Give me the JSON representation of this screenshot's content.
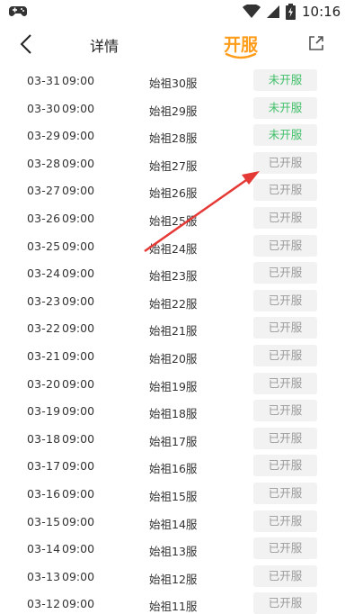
{
  "status_bar": {
    "time": "10:16",
    "icons": [
      "gamepad-icon",
      "wifi-icon",
      "signal-icon",
      "battery-icon"
    ]
  },
  "nav": {
    "title": "详情",
    "tab_label": "开服",
    "accent_color": "#ff9c1a"
  },
  "colors": {
    "upcoming_text": "#3fbf68",
    "opened_text": "#9a9a9a",
    "status_bg": "#f2f2f2",
    "annotation_arrow": "#e53935"
  },
  "servers": [
    {
      "date": "03-31",
      "time": "09:00",
      "name": "始祖30服",
      "status": "未开服",
      "state": "upcoming"
    },
    {
      "date": "03-30",
      "time": "09:00",
      "name": "始祖29服",
      "status": "未开服",
      "state": "upcoming"
    },
    {
      "date": "03-29",
      "time": "09:00",
      "name": "始祖28服",
      "status": "未开服",
      "state": "upcoming"
    },
    {
      "date": "03-28",
      "time": "09:00",
      "name": "始祖27服",
      "status": "已开服",
      "state": "opened"
    },
    {
      "date": "03-27",
      "time": "09:00",
      "name": "始祖26服",
      "status": "已开服",
      "state": "opened"
    },
    {
      "date": "03-26",
      "time": "09:00",
      "name": "始祖25服",
      "status": "已开服",
      "state": "opened"
    },
    {
      "date": "03-25",
      "time": "09:00",
      "name": "始祖24服",
      "status": "已开服",
      "state": "opened"
    },
    {
      "date": "03-24",
      "time": "09:00",
      "name": "始祖23服",
      "status": "已开服",
      "state": "opened"
    },
    {
      "date": "03-23",
      "time": "09:00",
      "name": "始祖22服",
      "status": "已开服",
      "state": "opened"
    },
    {
      "date": "03-22",
      "time": "09:00",
      "name": "始祖21服",
      "status": "已开服",
      "state": "opened"
    },
    {
      "date": "03-21",
      "time": "09:00",
      "name": "始祖20服",
      "status": "已开服",
      "state": "opened"
    },
    {
      "date": "03-20",
      "time": "09:00",
      "name": "始祖19服",
      "status": "已开服",
      "state": "opened"
    },
    {
      "date": "03-19",
      "time": "09:00",
      "name": "始祖18服",
      "status": "已开服",
      "state": "opened"
    },
    {
      "date": "03-18",
      "time": "09:00",
      "name": "始祖17服",
      "status": "已开服",
      "state": "opened"
    },
    {
      "date": "03-17",
      "time": "09:00",
      "name": "始祖16服",
      "status": "已开服",
      "state": "opened"
    },
    {
      "date": "03-16",
      "time": "09:00",
      "name": "始祖15服",
      "status": "已开服",
      "state": "opened"
    },
    {
      "date": "03-15",
      "time": "09:00",
      "name": "始祖14服",
      "status": "已开服",
      "state": "opened"
    },
    {
      "date": "03-14",
      "time": "09:00",
      "name": "始祖13服",
      "status": "已开服",
      "state": "opened"
    },
    {
      "date": "03-13",
      "time": "09:00",
      "name": "始祖12服",
      "status": "已开服",
      "state": "opened"
    },
    {
      "date": "03-12",
      "time": "09:00",
      "name": "始祖11服",
      "status": "已开服",
      "state": "opened"
    }
  ]
}
